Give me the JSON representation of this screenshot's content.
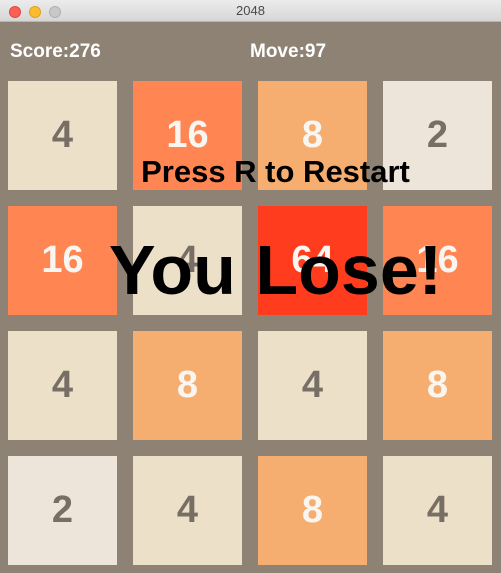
{
  "window": {
    "title": "2048"
  },
  "hud": {
    "score_text": "Score:276",
    "moves_text": "Move:97"
  },
  "overlay": {
    "restart_text": "Press R to Restart",
    "lose_text": "You Lose!"
  },
  "colors": {
    "background": "#8e8274",
    "tile_2": "#ede4da",
    "tile_4": "#ede0c8",
    "tile_8": "#f5ae6f",
    "tile_16": "#ff8653",
    "tile_64": "#ff3d1e",
    "dark_text": "#776e65",
    "light_text": "#f9f6f2"
  },
  "board": {
    "rows": [
      [
        4,
        16,
        8,
        2
      ],
      [
        16,
        4,
        64,
        16
      ],
      [
        4,
        8,
        4,
        8
      ],
      [
        2,
        4,
        8,
        4
      ]
    ]
  }
}
